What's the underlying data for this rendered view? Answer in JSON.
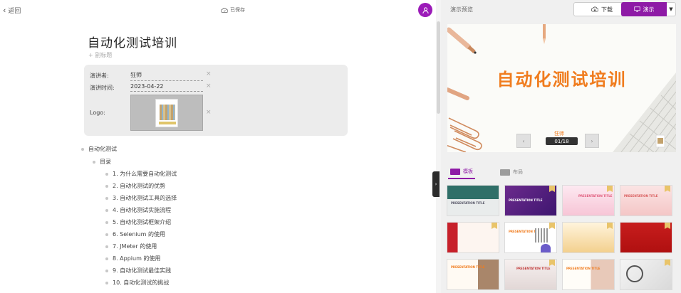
{
  "topbar": {
    "back_label": "返回",
    "saved_label": "已保存"
  },
  "document": {
    "title": "自动化测试培训",
    "add_subtitle": "+ 副标题",
    "meta": {
      "presenter_label": "演讲者:",
      "presenter_value": "狂师",
      "time_label": "演讲时间:",
      "time_value": "2023-04-22",
      "logo_label": "Logo:"
    },
    "outline": {
      "root": "自动化测试",
      "section": "目录",
      "items": [
        "1. 为什么需要自动化测试",
        "2. 自动化测试的优势",
        "3. 自动化测试工具的选择",
        "4. 自动化测试实施流程",
        "5. 自动化测试框架介绍",
        "6. Selenium 的使用",
        "7. JMeter 的使用",
        "8. Appium 的使用",
        "9. 自动化测试最佳实践",
        "10. 自动化测试的挑战"
      ]
    }
  },
  "preview": {
    "label": "演示预览",
    "download_label": "下载",
    "present_label": "演示",
    "slide": {
      "title": "自动化测试培训",
      "presenter": "狂师",
      "counter": "01/18"
    },
    "tabs": [
      {
        "label": "模板",
        "active": true
      },
      {
        "label": "布局",
        "active": false
      }
    ],
    "thumbnail_captions": [
      "PRESENTATION TITLE",
      "PRESENTATION TITLE",
      "PRESENTATION TITLE",
      "PRESENTATION TITLE",
      "PRESENTATION TITLE",
      "PRESENTATION TITLE",
      "PRESENTATION TITLE",
      "PRESENTATION TITLE"
    ],
    "colors": {
      "accent": "#8e1aa6",
      "slide_title": "#f07c1e"
    }
  }
}
